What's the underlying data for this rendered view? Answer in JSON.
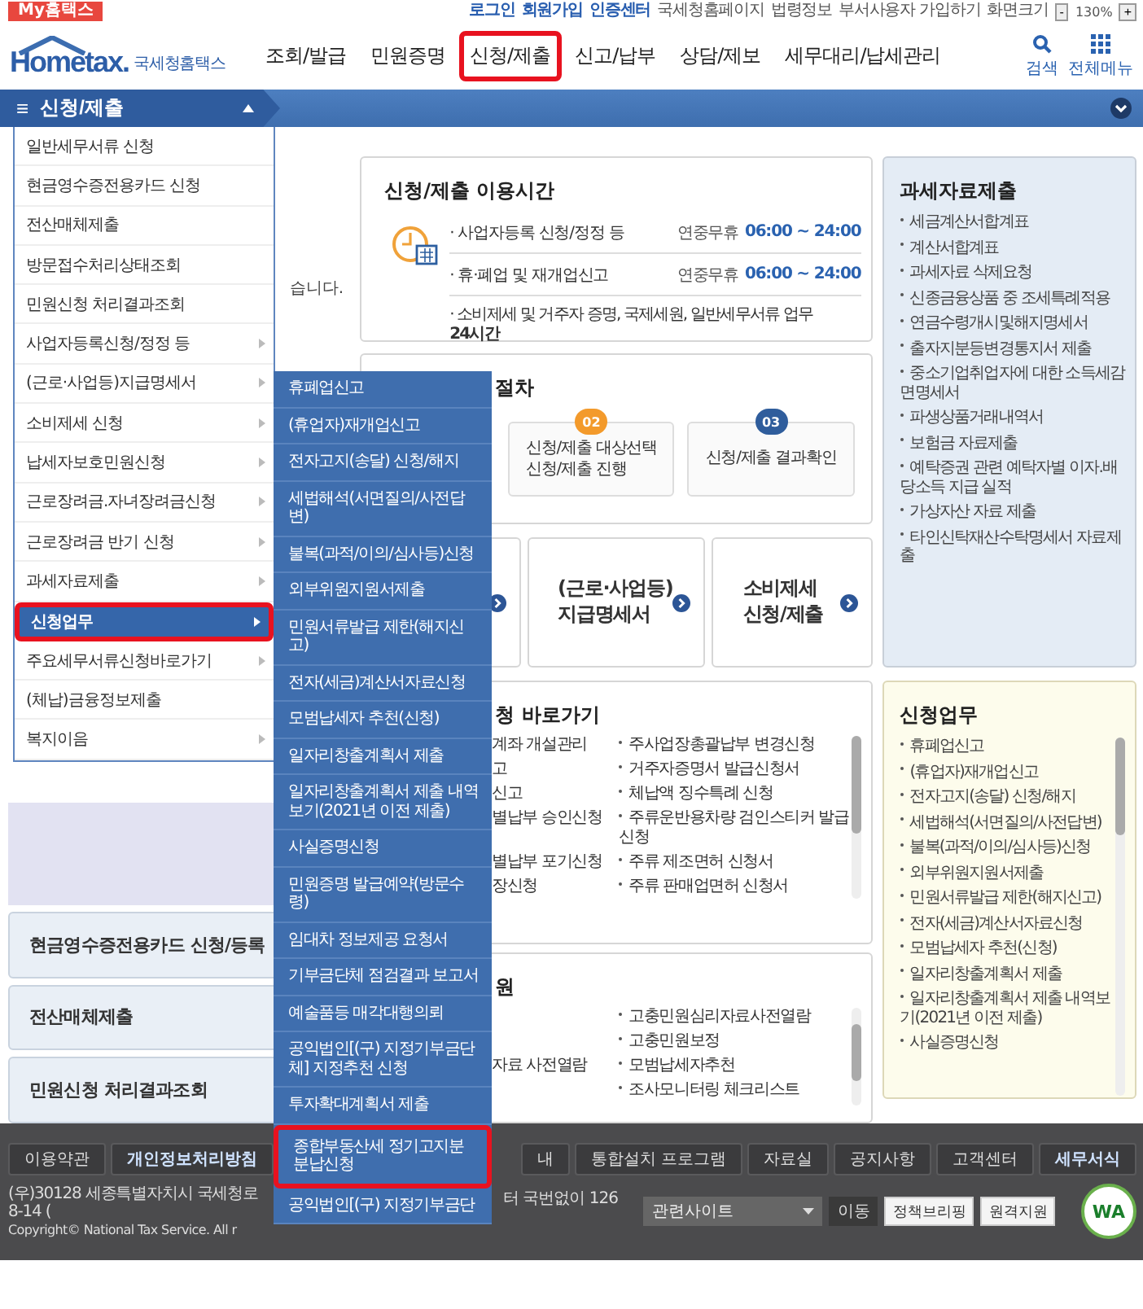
{
  "top_bar": {
    "badge": "My홈택스",
    "links": [
      {
        "label": "로그인",
        "emphasis": true
      },
      {
        "label": "회원가입",
        "emphasis": true
      },
      {
        "label": "인증센터",
        "emphasis": true
      },
      {
        "label": "국세청홈페이지",
        "emphasis": false
      },
      {
        "label": "법령정보",
        "emphasis": false
      },
      {
        "label": "부서사용자 가입하기",
        "emphasis": false
      }
    ],
    "zoom": {
      "label": "화면크기",
      "minus": "-",
      "value": "130%",
      "plus": "+"
    }
  },
  "header": {
    "logo": "Hometax.",
    "logo_sub": "국세청홈택스",
    "nav": [
      {
        "label": "조회/발급",
        "selected": false
      },
      {
        "label": "민원증명",
        "selected": false
      },
      {
        "label": "신청/제출",
        "selected": true
      },
      {
        "label": "신고/납부",
        "selected": false
      },
      {
        "label": "상담/제보",
        "selected": false
      },
      {
        "label": "세무대리/납세관리",
        "selected": false
      }
    ],
    "tools": [
      {
        "label": "검색",
        "kind": "search"
      },
      {
        "label": "전체메뉴",
        "kind": "grid"
      }
    ]
  },
  "menu_bar": {
    "icon": "≡",
    "label": "신청/제출",
    "expanded": true
  },
  "dropdown": {
    "items": [
      {
        "label": "일반세무서류 신청",
        "has_submenu": false,
        "selected": false
      },
      {
        "label": "현금영수증전용카드 신청",
        "has_submenu": false,
        "selected": false
      },
      {
        "label": "전산매체제출",
        "has_submenu": false,
        "selected": false
      },
      {
        "label": "방문접수처리상태조회",
        "has_submenu": false,
        "selected": false
      },
      {
        "label": "민원신청 처리결과조회",
        "has_submenu": false,
        "selected": false
      },
      {
        "label": "사업자등록신청/정정 등",
        "has_submenu": true,
        "selected": false
      },
      {
        "label": "(근로·사업등)지급명세서",
        "has_submenu": true,
        "selected": false
      },
      {
        "label": "소비제세 신청",
        "has_submenu": true,
        "selected": false
      },
      {
        "label": "납세자보호민원신청",
        "has_submenu": true,
        "selected": false
      },
      {
        "label": "근로장려금.자녀장려금신청",
        "has_submenu": true,
        "selected": false
      },
      {
        "label": "근로장려금 반기 신청",
        "has_submenu": true,
        "selected": false
      },
      {
        "label": "과세자료제출",
        "has_submenu": true,
        "selected": false
      },
      {
        "label": "신청업무",
        "has_submenu": true,
        "selected": true
      },
      {
        "label": "주요세무서류신청바로가기",
        "has_submenu": true,
        "selected": false
      },
      {
        "label": "(체납)금융정보제출",
        "has_submenu": false,
        "selected": false
      },
      {
        "label": "복지이음",
        "has_submenu": true,
        "selected": false
      }
    ]
  },
  "submenu": {
    "items": [
      {
        "label": "휴폐업신고",
        "highlighted": false
      },
      {
        "label": "(휴업자)재개업신고",
        "highlighted": false
      },
      {
        "label": "전자고지(송달) 신청/해지",
        "highlighted": false
      },
      {
        "label": "세법해석(서면질의/사전답변)",
        "highlighted": false
      },
      {
        "label": "불복(과적/이의/심사등)신청",
        "highlighted": false
      },
      {
        "label": "외부위원지원서제출",
        "highlighted": false
      },
      {
        "label": "민원서류발급 제한(해지신고)",
        "highlighted": false
      },
      {
        "label": "전자(세금)계산서자료신청",
        "highlighted": false
      },
      {
        "label": "모범납세자 추천(신청)",
        "highlighted": false
      },
      {
        "label": "일자리창출계획서 제출",
        "highlighted": false
      },
      {
        "label": "일자리창출계획서 제출 내역보기(2021년 이전 제출)",
        "highlighted": false
      },
      {
        "label": "사실증명신청",
        "highlighted": false
      },
      {
        "label": "민원증명 발급예약(방문수령)",
        "highlighted": false
      },
      {
        "label": "임대차 정보제공 요청서",
        "highlighted": false
      },
      {
        "label": "기부금단체 점검결과 보고서",
        "highlighted": false
      },
      {
        "label": "예술품등 매각대행의뢰",
        "highlighted": false
      },
      {
        "label": "공익법인[(구) 지정기부금단체] 지정추천 신청",
        "highlighted": false
      },
      {
        "label": "투자확대계획서 제출",
        "highlighted": false
      },
      {
        "label": "종합부동산세 정기고지분 분납신청",
        "highlighted": true
      },
      {
        "label": "공익법인[(구) 지정기부금단",
        "highlighted": false
      }
    ]
  },
  "left": {
    "notice": "습니다.",
    "cards": [
      "현금영수증전용카드 신청/등록",
      "전산매체제출",
      "민원신청 처리결과조회"
    ]
  },
  "hours": {
    "title": "신청/제출 이용시간",
    "rows": [
      {
        "label": "· 사업자등록 신청/정정 등",
        "days": "연중무휴",
        "time": "06:00 ~ 24:00"
      },
      {
        "label": "· 휴·폐업 및 재개업신고",
        "days": "연중무휴",
        "time": "06:00 ~ 24:00"
      }
    ],
    "note": "· 소비제세 및 거주자 증명, 국제세원, 일반세무서류 업무 **24시간**"
  },
  "procedure": {
    "title": "절차",
    "steps": [
      {
        "number": "02",
        "color": "#f39a2b",
        "lines": [
          "신청/제출 대상선택",
          "신청/제출 진행"
        ]
      },
      {
        "number": "03",
        "color": "#2f5d9c",
        "lines": [
          "신청/제출 결과확인"
        ]
      }
    ]
  },
  "quick_buttons": [
    {
      "lines": [
        "(근로·사업등)",
        "지급명세서"
      ]
    },
    {
      "lines": [
        "소비제세",
        "신청/제출"
      ]
    }
  ],
  "shortcuts": {
    "title": "청 바로가기",
    "rows": [
      {
        "left": "계좌 개설관리",
        "right": "주사업장총괄납부 변경신청"
      },
      {
        "left": "고",
        "right": "거주자증명서 발급신청서"
      },
      {
        "left": "신고",
        "right": "체납액 징수특례 신청"
      },
      {
        "left": "별납부 승인신청",
        "right": "주류운반용차량 검인스티커 발급신청"
      },
      {
        "left": "별납부 포기신청",
        "right": "주류 제조면허 신청서"
      },
      {
        "left": "장신청",
        "right": "주류 판매업면허 신청서"
      }
    ]
  },
  "complaints": {
    "title": "원",
    "rows": [
      {
        "right": "고충민원심리자료사전열람"
      },
      {
        "right": "고충민원보정"
      },
      {
        "left": "자료 사전열람",
        "right": "모범납세자추천"
      },
      {
        "right": "조사모니터링 체크리스트"
      }
    ]
  },
  "tax_data": {
    "title": "과세자료제출",
    "items": [
      "세금계산서합계표",
      "계산서합계표",
      "과세자료 삭제요청",
      "신종금융상품 중 조세특례적용",
      "연금수령개시및해지명세서",
      "출자지분등변경통지서 제출",
      "중소기업취업자에 대한 소득세감면명세서",
      "파생상품거래내역서",
      "보험금 자료제출",
      "예탁증권 관련 예탁자별 이자.배당소득 지급 실적",
      "가상자산 자료 제출",
      "타인신탁재산수탁명세서 자료제출"
    ]
  },
  "applications": {
    "title": "신청업무",
    "items": [
      "휴폐업신고",
      "(휴업자)재개업신고",
      "전자고지(송달) 신청/해지",
      "세법해석(서면질의/사전답변)",
      "불복(과적/이의/심사등)신청",
      "외부위원지원서제출",
      "민원서류발급 제한(해지신고)",
      "전자(세금)계산서자료신청",
      "모범납세자 추천(신청)",
      "일자리창출계획서 제출",
      "일자리창출계획서 제출 내역보기(2021년 이전 제출)",
      "사실증명신청"
    ]
  },
  "footer": {
    "links": [
      {
        "label": "이용약관",
        "bold": false
      },
      {
        "label": "개인정보처리방침",
        "bold": true
      }
    ],
    "links_right": [
      {
        "label": "내",
        "bold": false
      },
      {
        "label": "통합설치 프로그램",
        "bold": false
      },
      {
        "label": "자료실",
        "bold": false
      },
      {
        "label": "공지사항",
        "bold": false
      },
      {
        "label": "고객센터",
        "bold": false
      },
      {
        "label": "세무서식",
        "bold": true
      }
    ],
    "address": "(우)30128 세종특별자치시 국세청로 8-14 (",
    "phone": "터 국번없이 126",
    "copyright": "Copyright© National Tax Service. All r",
    "select": "관련사이트",
    "go": "이동",
    "policy": "정책브리핑",
    "remote": "원격지원",
    "mark": "WA"
  }
}
